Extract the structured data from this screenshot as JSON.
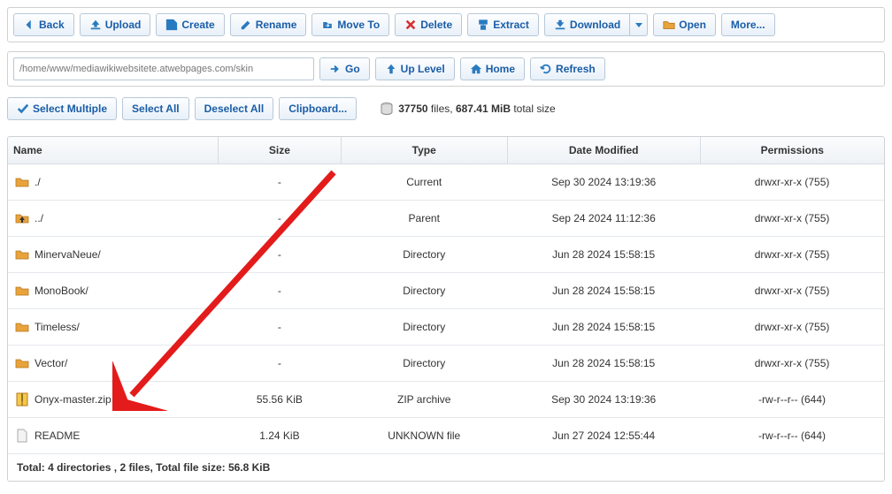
{
  "toolbar": {
    "back": "Back",
    "upload": "Upload",
    "create": "Create",
    "rename": "Rename",
    "moveto": "Move To",
    "delete": "Delete",
    "extract": "Extract",
    "download": "Download",
    "open": "Open",
    "more": "More..."
  },
  "nav": {
    "path": "/home/www/mediawikiwebsitete.atwebpages.com/skin",
    "go": "Go",
    "up_level": "Up Level",
    "home": "Home",
    "refresh": "Refresh"
  },
  "selection": {
    "select_multiple": "Select Multiple",
    "select_all": "Select All",
    "deselect_all": "Deselect All",
    "clipboard": "Clipboard..."
  },
  "stats": {
    "file_count": "37750",
    "files_word": "files,",
    "total_size": "687.41 MiB",
    "total_word": "total size"
  },
  "headers": {
    "name": "Name",
    "size": "Size",
    "type": "Type",
    "date": "Date Modified",
    "perm": "Permissions"
  },
  "rows": [
    {
      "icon": "folder",
      "name": "./",
      "size": "-",
      "type": "Current",
      "date": "Sep 30 2024 13:19:36",
      "perm": "drwxr-xr-x (755)"
    },
    {
      "icon": "folder-up",
      "name": "../",
      "size": "-",
      "type": "Parent",
      "date": "Sep 24 2024 11:12:36",
      "perm": "drwxr-xr-x (755)"
    },
    {
      "icon": "folder",
      "name": "MinervaNeue/",
      "size": "-",
      "type": "Directory",
      "date": "Jun 28 2024 15:58:15",
      "perm": "drwxr-xr-x (755)"
    },
    {
      "icon": "folder",
      "name": "MonoBook/",
      "size": "-",
      "type": "Directory",
      "date": "Jun 28 2024 15:58:15",
      "perm": "drwxr-xr-x (755)"
    },
    {
      "icon": "folder",
      "name": "Timeless/",
      "size": "-",
      "type": "Directory",
      "date": "Jun 28 2024 15:58:15",
      "perm": "drwxr-xr-x (755)"
    },
    {
      "icon": "folder",
      "name": "Vector/",
      "size": "-",
      "type": "Directory",
      "date": "Jun 28 2024 15:58:15",
      "perm": "drwxr-xr-x (755)"
    },
    {
      "icon": "zip",
      "name": "Onyx-master.zip",
      "size": "55.56 KiB",
      "type": "ZIP archive",
      "date": "Sep 30 2024 13:19:36",
      "perm": "-rw-r--r-- (644)"
    },
    {
      "icon": "file",
      "name": "README",
      "size": "1.24 KiB",
      "type": "UNKNOWN file",
      "date": "Jun 27 2024 12:55:44",
      "perm": "-rw-r--r-- (644)"
    }
  ],
  "footer": "Total: 4 directories , 2 files, Total file size: 56.8 KiB"
}
